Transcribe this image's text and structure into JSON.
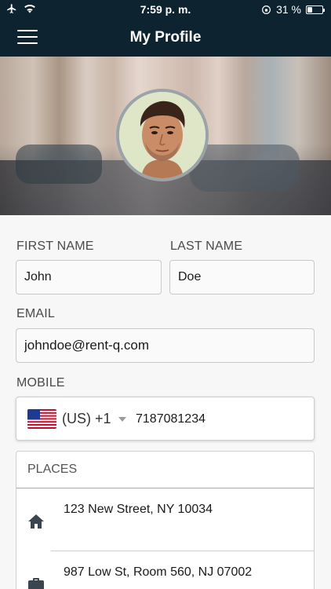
{
  "status_bar": {
    "time": "7:59 p. m.",
    "battery": "31 %",
    "battery_level": 0.31
  },
  "header": {
    "title": "My Profile",
    "menu_icon": "hamburger-menu-icon"
  },
  "profile": {
    "first_name_label": "FIRST NAME",
    "first_name": "John",
    "last_name_label": "LAST NAME",
    "last_name": "Doe",
    "email_label": "EMAIL",
    "email": "johndoe@rent-q.com",
    "mobile_label": "MOBILE",
    "country_code": "(US) +1",
    "country_flag": "us-flag-icon",
    "phone": "7187081234"
  },
  "places": {
    "title": "PLACES",
    "items": [
      {
        "icon": "home-icon",
        "address": "123 New Street, NY 10034"
      },
      {
        "icon": "briefcase-icon",
        "address": "987 Low St, Room 560, NJ 07002"
      }
    ]
  },
  "colors": {
    "header_bg": "#0d2330",
    "divider_accent": "#7fc37c"
  }
}
